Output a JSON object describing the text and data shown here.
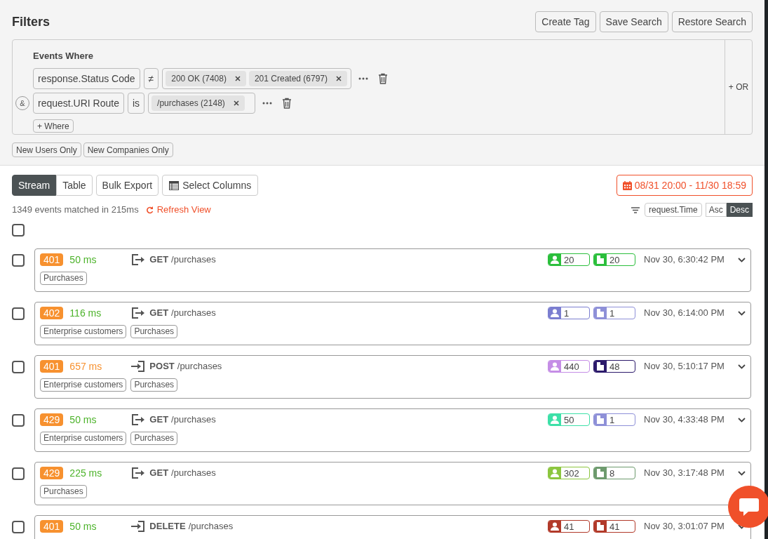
{
  "filters": {
    "title": "Filters",
    "buttons": [
      "Create Tag",
      "Save Search",
      "Restore Search"
    ],
    "heading": "Events Where",
    "conditions": [
      {
        "field": "response.Status Code",
        "operator": "≠",
        "values": [
          "200 OK (7408)",
          "201 Created (6797)"
        ]
      },
      {
        "joiner": "&",
        "field": "request.URI Route",
        "operator": "is",
        "values": [
          "/purchases (2148)"
        ]
      }
    ],
    "add_where": "+ Where",
    "or_button": "+ OR",
    "quick_filters": [
      "New Users Only",
      "New Companies Only"
    ]
  },
  "toolbar": {
    "views": [
      {
        "label": "Stream",
        "selected": true
      },
      {
        "label": "Table",
        "selected": false
      }
    ],
    "bulk_export": "Bulk Export",
    "select_columns": "Select Columns",
    "date_range": "08/31 20:00 - 11/30 18:59"
  },
  "summary": {
    "matched": "1349 events matched in 215ms",
    "refresh": "Refresh View",
    "sort_field": "request.Time",
    "orders": [
      {
        "label": "Asc",
        "selected": false
      },
      {
        "label": "Desc",
        "selected": true
      }
    ]
  },
  "select_all": {
    "checked": false
  },
  "events": [
    {
      "checked": false,
      "status": "401",
      "duration": {
        "text": "50 ms",
        "color": "#4cb32a"
      },
      "kind": "outgoing",
      "method": "GET",
      "path": "/purchases",
      "tags": [
        "Purchases"
      ],
      "users": {
        "count": "20",
        "color": "#2bbf3c"
      },
      "companies": {
        "count": "20",
        "color": "#2bbf3c"
      },
      "time": "Nov 30, 6:30:42 PM"
    },
    {
      "checked": false,
      "status": "402",
      "duration": {
        "text": "116 ms",
        "color": "#4cb32a"
      },
      "kind": "outgoing",
      "method": "GET",
      "path": "/purchases",
      "tags": [
        "Enterprise customers",
        "Purchases"
      ],
      "users": {
        "count": "1",
        "color": "#7b7ed0"
      },
      "companies": {
        "count": "1",
        "color": "#8e90d8"
      },
      "time": "Nov 30, 6:14:00 PM"
    },
    {
      "checked": false,
      "status": "401",
      "duration": {
        "text": "657 ms",
        "color": "#f7912f"
      },
      "kind": "incoming",
      "method": "POST",
      "path": "/purchases",
      "tags": [
        "Enterprise customers",
        "Purchases"
      ],
      "users": {
        "count": "440",
        "color": "#c58ee6"
      },
      "companies": {
        "count": "48",
        "color": "#2c1a6b"
      },
      "time": "Nov 30, 5:10:17 PM"
    },
    {
      "checked": false,
      "status": "429",
      "duration": {
        "text": "50 ms",
        "color": "#4cb32a"
      },
      "kind": "outgoing",
      "method": "GET",
      "path": "/purchases",
      "tags": [
        "Enterprise customers",
        "Purchases"
      ],
      "users": {
        "count": "50",
        "color": "#3de0a8"
      },
      "companies": {
        "count": "1",
        "color": "#8e90d8"
      },
      "time": "Nov 30, 4:33:48 PM"
    },
    {
      "checked": false,
      "status": "429",
      "duration": {
        "text": "225 ms",
        "color": "#4cb32a"
      },
      "kind": "outgoing",
      "method": "GET",
      "path": "/purchases",
      "tags": [
        "Purchases"
      ],
      "users": {
        "count": "302",
        "color": "#8cc63f"
      },
      "companies": {
        "count": "8",
        "color": "#6d9a6d"
      },
      "time": "Nov 30, 3:17:48 PM"
    },
    {
      "checked": false,
      "status": "401",
      "duration": {
        "text": "50 ms",
        "color": "#4cb32a"
      },
      "kind": "incoming",
      "method": "DELETE",
      "path": "/purchases",
      "users": {
        "count": "41",
        "color": "#b23a2a"
      },
      "companies": {
        "count": "41",
        "color": "#b23a2a"
      },
      "time": "Nov 30, 3:01:07 PM"
    }
  ]
}
